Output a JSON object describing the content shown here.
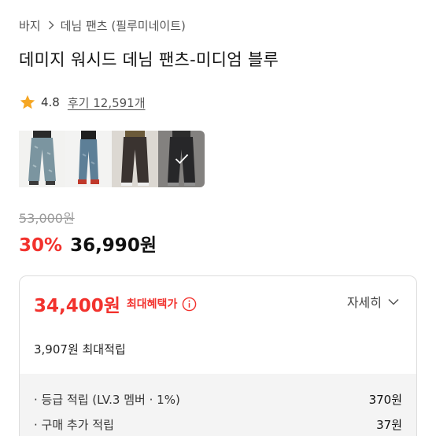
{
  "breadcrumb": {
    "root": "바지",
    "current": "데님 팬츠 (필루미네이트)"
  },
  "product": {
    "title": "데미지 워시드 데님 팬츠-미디엄 블루",
    "rating": "4.8",
    "reviews_label": "후기 12,591개"
  },
  "gallery": {
    "thumbnails": [
      "denim-light-wash-front",
      "denim-blue-back",
      "pants-dark-brown",
      "pants-charcoal"
    ],
    "selected_index": 3
  },
  "pricing": {
    "original": "53,000원",
    "discount": "30%",
    "sale": "36,990원"
  },
  "benefit": {
    "max_price": "34,400원",
    "max_label": "최대혜택가",
    "detail_label": "자세히",
    "points_summary": "3,907원 최대적립",
    "points": [
      {
        "label": "· 등급 적립 (LV.3 멤버 · 1%)",
        "value": "370원"
      },
      {
        "label": "· 구매 추가 적립",
        "value": "37원"
      }
    ]
  },
  "colors": {
    "accent_red": "#f2322d",
    "star": "#f5a623",
    "panel_bg": "#f4f4f4"
  }
}
